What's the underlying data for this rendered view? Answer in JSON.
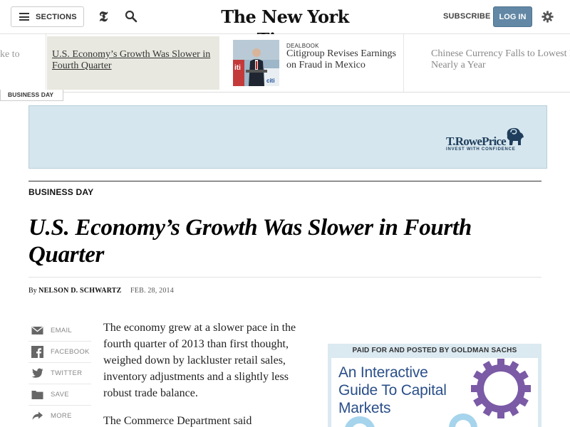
{
  "topbar": {
    "sections_label": "SECTIONS",
    "masthead": "The New York Times",
    "subscribe_label": "SUBSCRIBE",
    "login_label": "LOG IN"
  },
  "ribbon": {
    "prev_headline": "ke to",
    "current_headline": "U.S. Economy’s Growth Was Slower in Fourth Quarter",
    "deal_kicker": "DEALBOOK",
    "deal_headline": "Citigroup Revises Earnings on Fraud in Mexico",
    "next_headline": "Chinese Currency Falls to Lowest L in Nearly a Year"
  },
  "section_tab": "BUSINESS DAY",
  "ad_banner": {
    "brand": "T.RowePrice",
    "tagline": "INVEST WITH CONFIDENCE"
  },
  "article": {
    "kicker": "BUSINESS DAY",
    "title": "U.S. Economy’s Growth Was Slower in Fourth Quarter",
    "byline_by": "By",
    "author": "NELSON D. SCHWARTZ",
    "date": "FEB. 28, 2014",
    "paragraphs": [
      "The economy grew at a slower pace in the fourth quarter of 2013 than first thought, weighed down by lackluster retail sales, inventory adjustments and a slightly less robust trade balance.",
      "The Commerce Department said"
    ]
  },
  "share": {
    "email": "EMAIL",
    "facebook": "FACEBOOK",
    "twitter": "TWITTER",
    "save": "SAVE",
    "more": "MORE"
  },
  "side_ad": {
    "label": "PAID FOR AND POSTED BY GOLDMAN SACHS",
    "title": "An Interactive Guide To Capital Markets"
  },
  "colors": {
    "login": "#6288a5",
    "ad_banner_bg": "#d6e6ee",
    "brand_navy": "#1e3e5c",
    "ad_title_blue": "#2a4f8a",
    "gear_purple": "#7b5aa6"
  }
}
